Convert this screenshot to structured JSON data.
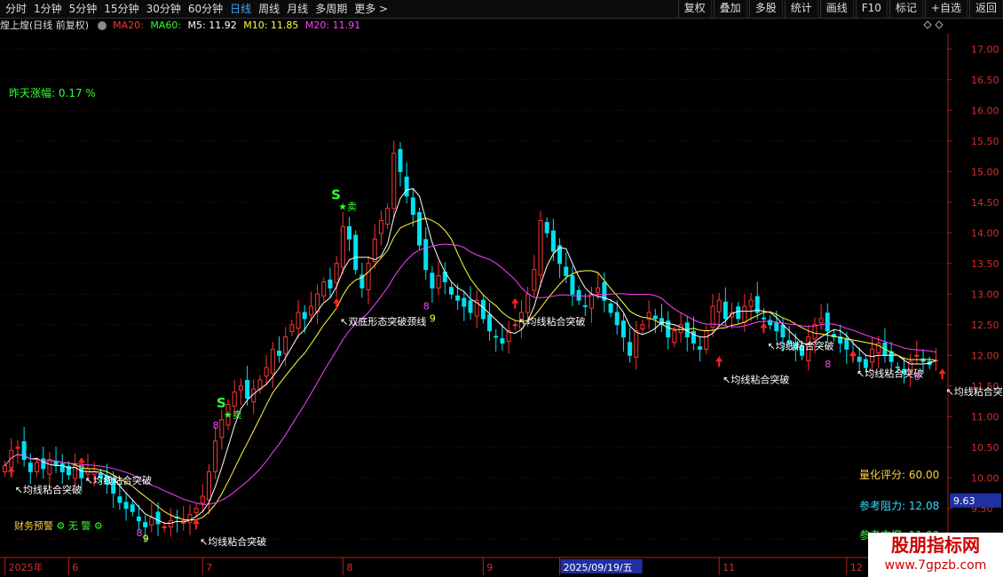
{
  "toolbar": {
    "periods": [
      "分时",
      "1分钟",
      "5分钟",
      "15分钟",
      "30分钟",
      "60分钟",
      "日线",
      "周线",
      "月线",
      "多周期",
      "更多 >"
    ],
    "active_period": "日线",
    "buttons": [
      "复权",
      "叠加",
      "多股",
      "统计",
      "画线",
      "F10",
      "标记",
      "+自选",
      "返回"
    ]
  },
  "info": {
    "name": "煌上煌(日线 前复权)",
    "ma20_label": "MA20:",
    "ma60_label": "MA60:",
    "m5": "M5: 11.92",
    "m10": "M10: 11.85",
    "m20": "M20: 11.91"
  },
  "colors": {
    "up": "#ff3333",
    "down": "#00e0f0",
    "ma5": "#ffffff",
    "ma10": "#ffff40",
    "ma20": "#ff40ff",
    "axis": "#b02020"
  },
  "yesterday": {
    "label": "昨天涨幅:",
    "value": "0.17 %"
  },
  "finance_warning": {
    "label": "财务预警",
    "value": "无 警"
  },
  "side_panel": {
    "score": "量化评分: 60.00",
    "resistance": "参考阻力: 12.08",
    "support": "参考支撑: 11.09"
  },
  "current_price_tag": "9.63",
  "chart_data": {
    "type": "candlestick",
    "ylim": [
      8.7,
      17.25
    ],
    "yticks": [
      "17.00",
      "16.50",
      "16.00",
      "15.50",
      "15.00",
      "14.50",
      "14.00",
      "13.50",
      "13.00",
      "12.50",
      "12.00",
      "11.50",
      "11.00",
      "10.50",
      "10.00",
      "9.50",
      "9.00"
    ],
    "x_labels": [
      {
        "label": "2025年",
        "i": 0
      },
      {
        "label": "6",
        "i": 10
      },
      {
        "label": "7",
        "i": 31
      },
      {
        "label": "8",
        "i": 53
      },
      {
        "label": "9",
        "i": 75
      },
      {
        "label": "2025/09/19/五",
        "i": 87,
        "highlight": true
      },
      {
        "label": "11",
        "i": 112
      },
      {
        "label": "12",
        "i": 132
      }
    ],
    "close": [
      10.2,
      10.45,
      10.5,
      10.3,
      10.1,
      10.25,
      10.15,
      10.3,
      10.2,
      10.1,
      10.05,
      10.2,
      10.0,
      10.15,
      10.1,
      10.0,
      9.9,
      9.75,
      9.6,
      9.5,
      9.45,
      9.3,
      9.2,
      9.35,
      9.25,
      9.2,
      9.3,
      9.35,
      9.3,
      9.4,
      9.5,
      9.7,
      10.1,
      10.6,
      10.95,
      11.2,
      11.4,
      11.5,
      11.3,
      11.45,
      11.6,
      11.8,
      12.1,
      12.0,
      12.3,
      12.5,
      12.7,
      12.6,
      12.8,
      13.0,
      13.2,
      13.1,
      13.5,
      14.1,
      13.9,
      13.4,
      13.1,
      13.5,
      13.9,
      14.2,
      14.4,
      15.3,
      15.0,
      14.6,
      14.3,
      13.8,
      13.4,
      13.1,
      13.3,
      13.2,
      13.0,
      12.9,
      12.8,
      12.7,
      12.9,
      12.6,
      12.4,
      12.3,
      12.2,
      12.4,
      12.5,
      12.7,
      13.0,
      13.4,
      14.2,
      14.0,
      13.7,
      13.5,
      13.3,
      13.0,
      12.9,
      12.8,
      13.0,
      13.1,
      12.9,
      12.7,
      12.5,
      12.3,
      12.0,
      12.4,
      12.5,
      12.7,
      12.6,
      12.5,
      12.3,
      12.4,
      12.5,
      12.3,
      12.2,
      12.1,
      12.4,
      12.8,
      12.9,
      12.6,
      12.7,
      12.6,
      12.8,
      12.9,
      12.7,
      12.6,
      12.5,
      12.4,
      12.3,
      12.2,
      12.1,
      12.0,
      12.3,
      12.5,
      12.6,
      12.4,
      12.3,
      12.2,
      12.1,
      12.0,
      11.9,
      11.8,
      12.1,
      12.2,
      12.0,
      11.9,
      11.8,
      11.7,
      11.9,
      12.0,
      11.9,
      11.85,
      11.92
    ],
    "ma_labels": [
      "MA5",
      "MA10",
      "MA20"
    ]
  },
  "annotations": {
    "s_marks": [
      {
        "text": "S",
        "i": 52,
        "p": 14.55
      },
      {
        "text": "S",
        "i": 34,
        "p": 11.15
      }
    ],
    "sell_text": "卖",
    "breakouts": [
      {
        "text": "均线粘合突破",
        "i": 1,
        "p": 9.75
      },
      {
        "text": "均线粘合突破",
        "i": 12,
        "p": 9.9
      },
      {
        "text": "均线粘合突破",
        "i": 30,
        "p": 8.9
      },
      {
        "text": "双底形态突破颈线",
        "i": 52,
        "p": 12.5
      },
      {
        "text": "均线粘合突破",
        "i": 80,
        "p": 12.5
      },
      {
        "text": "均线粘合突破",
        "i": 112,
        "p": 11.55
      },
      {
        "text": "均线粘合突破",
        "i": 119,
        "p": 12.1
      },
      {
        "text": "均线粘合突破",
        "i": 133,
        "p": 11.65
      },
      {
        "text": "均线粘合突破",
        "i": 147,
        "p": 11.35
      },
      {
        "text": "均线",
        "i": 158,
        "p": 11.35
      }
    ],
    "nums": [
      {
        "t": "8",
        "i": 21,
        "p": 9.05,
        "c": "#ff40ff"
      },
      {
        "t": "9",
        "i": 22,
        "p": 8.95,
        "c": "#ffff40"
      },
      {
        "t": "8",
        "i": 33,
        "p": 10.8,
        "c": "#ff40ff"
      },
      {
        "t": "8",
        "i": 66,
        "p": 12.75,
        "c": "#ff40ff"
      },
      {
        "t": "9",
        "i": 67,
        "p": 12.55,
        "c": "#ffff40"
      },
      {
        "t": "8",
        "i": 129,
        "p": 11.8,
        "c": "#ff40ff"
      },
      {
        "t": "8",
        "i": 143,
        "p": 11.6,
        "c": "#ff40ff"
      }
    ]
  },
  "watermark": {
    "title": "股朋指标网",
    "url": "www.7gpzb.com"
  }
}
